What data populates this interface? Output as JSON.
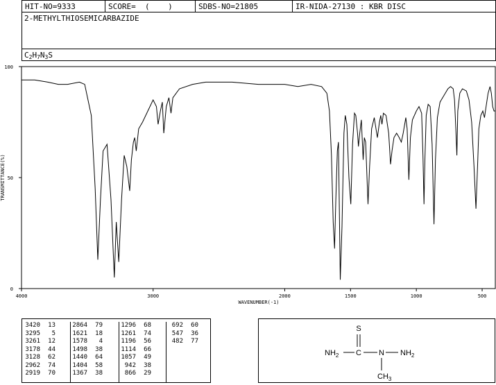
{
  "header": {
    "hit_no": "HIT-NO=9333",
    "score": "SCORE=  (    )",
    "sdbs_no": "SDBS-NO=21805",
    "ir_nida": "IR-NIDA-27130 : KBR DISC"
  },
  "compound": {
    "name": "2-METHYLTHIOSEMICARBAZIDE",
    "formula_parts": [
      "C",
      "2",
      "H",
      "7",
      "N",
      "3",
      "S"
    ]
  },
  "chart_data": {
    "type": "line",
    "xlabel": "WAVENUMBER(-1)",
    "ylabel": "TRANSMITTANCE(%)",
    "xlim": [
      4000,
      400
    ],
    "ylim": [
      0,
      100
    ],
    "x_ticks": [
      4000,
      3000,
      2000,
      1500,
      1000,
      500
    ],
    "x_tick_labels": [
      "4000",
      "3000",
      "2000",
      "1500",
      "1000",
      "500"
    ],
    "y_ticks": [
      0,
      50,
      100
    ],
    "y_tick_labels": [
      "0",
      "50",
      "100"
    ],
    "series": [
      {
        "color": "#000000",
        "points": [
          [
            4000,
            94
          ],
          [
            3900,
            94
          ],
          [
            3800,
            93
          ],
          [
            3720,
            92
          ],
          [
            3650,
            92
          ],
          [
            3560,
            93
          ],
          [
            3520,
            92
          ],
          [
            3470,
            78
          ],
          [
            3440,
            45
          ],
          [
            3420,
            13
          ],
          [
            3400,
            40
          ],
          [
            3380,
            62
          ],
          [
            3350,
            65
          ],
          [
            3320,
            40
          ],
          [
            3295,
            5
          ],
          [
            3280,
            30
          ],
          [
            3261,
            12
          ],
          [
            3240,
            40
          ],
          [
            3220,
            60
          ],
          [
            3200,
            55
          ],
          [
            3178,
            44
          ],
          [
            3165,
            58
          ],
          [
            3150,
            66
          ],
          [
            3140,
            68
          ],
          [
            3128,
            62
          ],
          [
            3110,
            72
          ],
          [
            3080,
            75
          ],
          [
            3040,
            80
          ],
          [
            3000,
            85
          ],
          [
            2975,
            82
          ],
          [
            2962,
            74
          ],
          [
            2945,
            80
          ],
          [
            2930,
            84
          ],
          [
            2919,
            70
          ],
          [
            2900,
            82
          ],
          [
            2880,
            86
          ],
          [
            2864,
            79
          ],
          [
            2850,
            86
          ],
          [
            2800,
            90
          ],
          [
            2700,
            92
          ],
          [
            2600,
            93
          ],
          [
            2400,
            93
          ],
          [
            2200,
            92
          ],
          [
            2000,
            92
          ],
          [
            1900,
            91
          ],
          [
            1800,
            92
          ],
          [
            1720,
            91
          ],
          [
            1680,
            88
          ],
          [
            1660,
            80
          ],
          [
            1645,
            60
          ],
          [
            1632,
            30
          ],
          [
            1621,
            18
          ],
          [
            1612,
            40
          ],
          [
            1600,
            62
          ],
          [
            1592,
            66
          ],
          [
            1585,
            35
          ],
          [
            1578,
            4
          ],
          [
            1565,
            28
          ],
          [
            1550,
            70
          ],
          [
            1540,
            78
          ],
          [
            1528,
            74
          ],
          [
            1512,
            50
          ],
          [
            1498,
            38
          ],
          [
            1485,
            65
          ],
          [
            1470,
            79
          ],
          [
            1460,
            78
          ],
          [
            1447,
            70
          ],
          [
            1440,
            64
          ],
          [
            1430,
            70
          ],
          [
            1418,
            76
          ],
          [
            1404,
            58
          ],
          [
            1395,
            68
          ],
          [
            1385,
            66
          ],
          [
            1367,
            38
          ],
          [
            1355,
            55
          ],
          [
            1340,
            72
          ],
          [
            1320,
            77
          ],
          [
            1296,
            68
          ],
          [
            1280,
            75
          ],
          [
            1270,
            78
          ],
          [
            1261,
            74
          ],
          [
            1250,
            79
          ],
          [
            1230,
            78
          ],
          [
            1210,
            70
          ],
          [
            1196,
            56
          ],
          [
            1185,
            62
          ],
          [
            1170,
            68
          ],
          [
            1150,
            70
          ],
          [
            1130,
            68
          ],
          [
            1114,
            66
          ],
          [
            1100,
            70
          ],
          [
            1080,
            77
          ],
          [
            1070,
            72
          ],
          [
            1057,
            49
          ],
          [
            1045,
            68
          ],
          [
            1030,
            76
          ],
          [
            1000,
            80
          ],
          [
            980,
            82
          ],
          [
            960,
            79
          ],
          [
            950,
            60
          ],
          [
            942,
            38
          ],
          [
            935,
            58
          ],
          [
            925,
            78
          ],
          [
            910,
            83
          ],
          [
            895,
            82
          ],
          [
            880,
            65
          ],
          [
            866,
            29
          ],
          [
            855,
            58
          ],
          [
            840,
            77
          ],
          [
            820,
            84
          ],
          [
            800,
            86
          ],
          [
            780,
            88
          ],
          [
            760,
            90
          ],
          [
            740,
            91
          ],
          [
            720,
            90
          ],
          [
            710,
            85
          ],
          [
            700,
            72
          ],
          [
            692,
            60
          ],
          [
            685,
            80
          ],
          [
            670,
            88
          ],
          [
            650,
            90
          ],
          [
            620,
            89
          ],
          [
            600,
            85
          ],
          [
            580,
            75
          ],
          [
            562,
            55
          ],
          [
            547,
            36
          ],
          [
            535,
            55
          ],
          [
            525,
            72
          ],
          [
            510,
            78
          ],
          [
            495,
            80
          ],
          [
            482,
            77
          ],
          [
            470,
            82
          ],
          [
            455,
            88
          ],
          [
            440,
            91
          ],
          [
            430,
            88
          ],
          [
            420,
            82
          ],
          [
            410,
            80
          ],
          [
            400,
            80
          ]
        ]
      }
    ]
  },
  "peak_table": [
    [
      [
        "3420",
        "13"
      ],
      [
        "3295",
        "5"
      ],
      [
        "3261",
        "12"
      ],
      [
        "3178",
        "44"
      ],
      [
        "3128",
        "62"
      ],
      [
        "2962",
        "74"
      ],
      [
        "2919",
        "70"
      ]
    ],
    [
      [
        "2864",
        "79"
      ],
      [
        "1621",
        "18"
      ],
      [
        "1578",
        "4"
      ],
      [
        "1498",
        "38"
      ],
      [
        "1440",
        "64"
      ],
      [
        "1404",
        "58"
      ],
      [
        "1367",
        "38"
      ]
    ],
    [
      [
        "1296",
        "68"
      ],
      [
        "1261",
        "74"
      ],
      [
        "1196",
        "56"
      ],
      [
        "1114",
        "66"
      ],
      [
        "1057",
        "49"
      ],
      [
        "942",
        "38"
      ],
      [
        "866",
        "29"
      ]
    ],
    [
      [
        "692",
        "60"
      ],
      [
        "547",
        "36"
      ],
      [
        "482",
        "77"
      ]
    ]
  ],
  "structure": {
    "atom_S": "S",
    "atom_C": "C",
    "atom_N": "N",
    "left_group": [
      "NH",
      "2"
    ],
    "right_group": [
      "NH",
      "2"
    ],
    "bottom_group": [
      "CH",
      "3"
    ]
  }
}
